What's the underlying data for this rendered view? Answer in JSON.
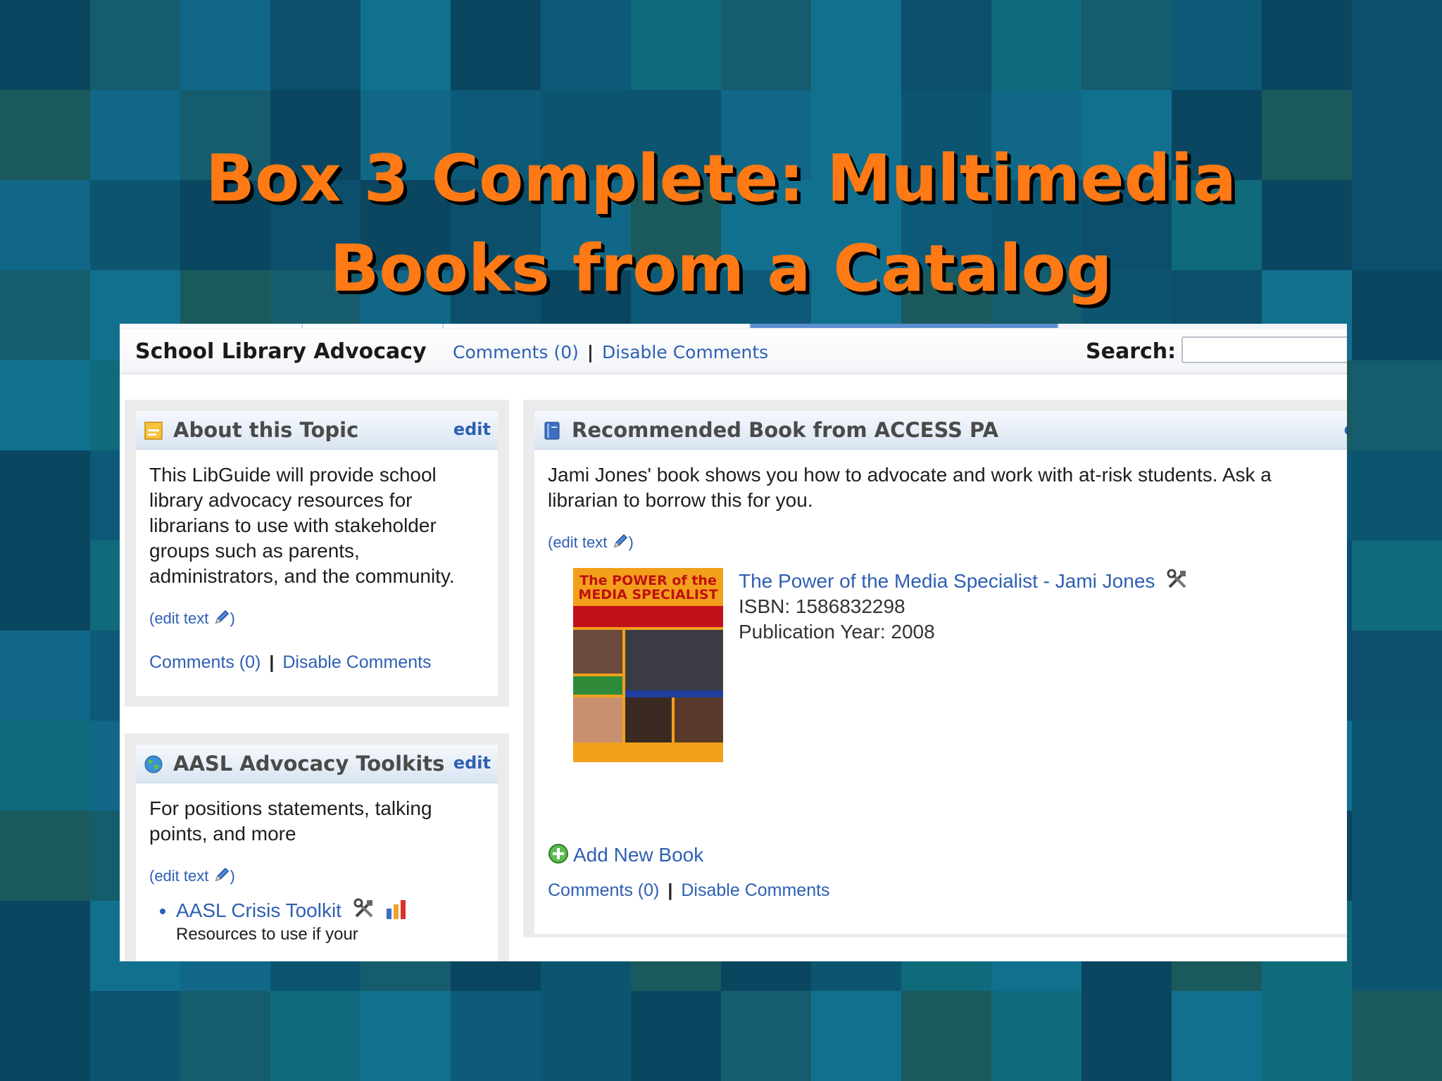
{
  "slide": {
    "title_line1": "Box 3 Complete: Multimedia",
    "title_line2": "Books from a Catalog"
  },
  "guide": {
    "title": "School Library Advocacy",
    "comments_link": "Comments (0)",
    "separator": "|",
    "disable_comments": "Disable Comments",
    "search_label": "Search:",
    "search_value": ""
  },
  "about_box": {
    "icon": "note-icon",
    "title": "About this Topic",
    "edit_label": "edit",
    "body": "This LibGuide will provide school library advocacy resources for librarians to use with stakeholder groups such as parents, administrators, and the community.",
    "edit_text": "(edit text",
    "edit_text_close": ")",
    "comments": "Comments (0)",
    "separator": "|",
    "disable_comments": "Disable Comments"
  },
  "aasl_box": {
    "icon": "globe-icon",
    "title": "AASL Advocacy Toolkits",
    "edit_label": "edit",
    "body": "For positions statements, talking points, and more",
    "edit_text": "(edit text",
    "edit_text_close": ")",
    "links": [
      {
        "label": "AASL Crisis Toolkit",
        "description": "Resources to use if your"
      }
    ]
  },
  "book_box": {
    "icon": "book-icon",
    "title": "Recommended Book from ACCESS PA",
    "edit_label": "e",
    "body": "Jami Jones' book shows you how to advocate and work with at-risk students. Ask a librarian to borrow this for you.",
    "edit_text": "(edit text",
    "edit_text_close": ")",
    "book": {
      "title": "The Power of the Media Specialist",
      "author_sep": " - ",
      "author": "Jami Jones",
      "isbn": "ISBN: 1586832298",
      "year": "Publication Year: 2008",
      "cover_title_a": "The POWER of the",
      "cover_title_b": "MEDIA SPECIALIST"
    },
    "add_new": "Add New Book",
    "comments": "Comments (0)",
    "separator": "|",
    "disable_comments": "Disable Comments"
  },
  "colors": {
    "title_orange": "#ff7a14",
    "link_blue": "#2e5fb3",
    "bg_teal": "#0e5f7f"
  }
}
